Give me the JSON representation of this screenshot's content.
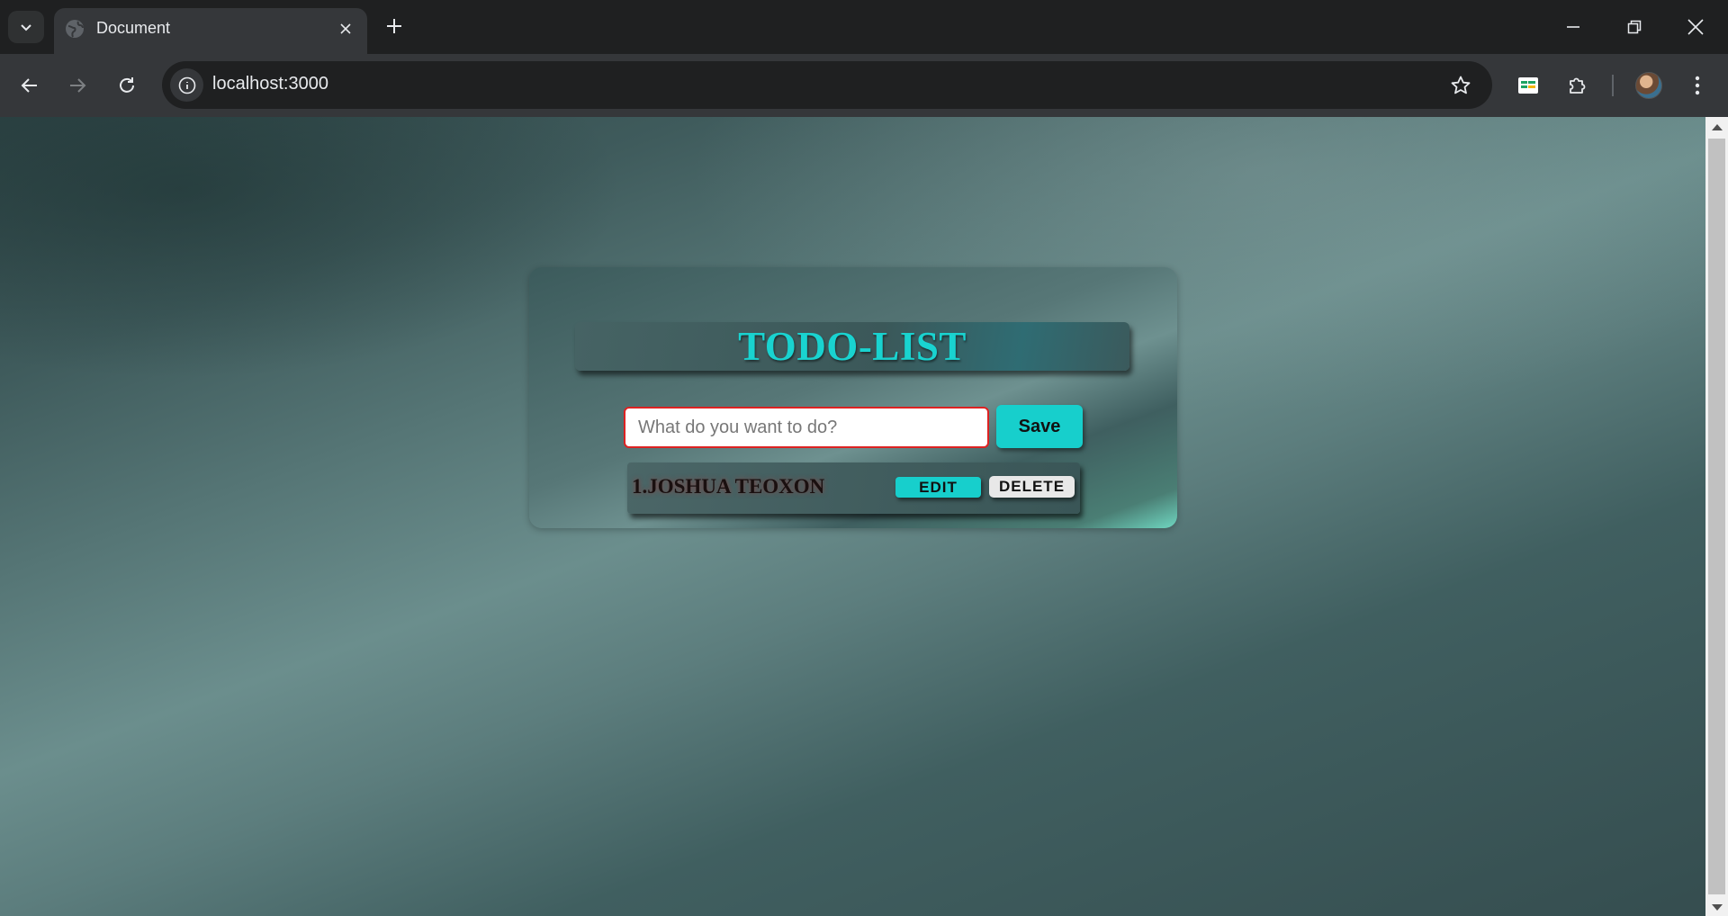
{
  "browser": {
    "tab_title": "Document",
    "url": "localhost:3000",
    "icons": {
      "tab_search": "chevron-down-icon",
      "tab_favicon": "globe-icon",
      "tab_close": "close-icon",
      "new_tab": "plus-icon",
      "back": "arrow-left-icon",
      "forward": "arrow-right-icon",
      "reload": "reload-icon",
      "site_info": "info-icon",
      "bookmark": "star-icon",
      "extension_1": "sheet-extension-icon",
      "extensions": "puzzle-icon",
      "menu": "kebab-menu-icon",
      "minimize": "minimize-icon",
      "restore": "restore-icon",
      "close_window": "close-icon"
    }
  },
  "app": {
    "title": "TODO-LIST",
    "input": {
      "placeholder": "What do you want to do?",
      "value": ""
    },
    "save_label": "Save",
    "todos": [
      {
        "text": "1.JOSHUA TEOXON",
        "edit_label": "EDIT",
        "delete_label": "DELETE"
      }
    ]
  },
  "colors": {
    "accent": "#17cfcc",
    "input_border": "#dd2222",
    "delete_bg": "#e8e8e8"
  }
}
